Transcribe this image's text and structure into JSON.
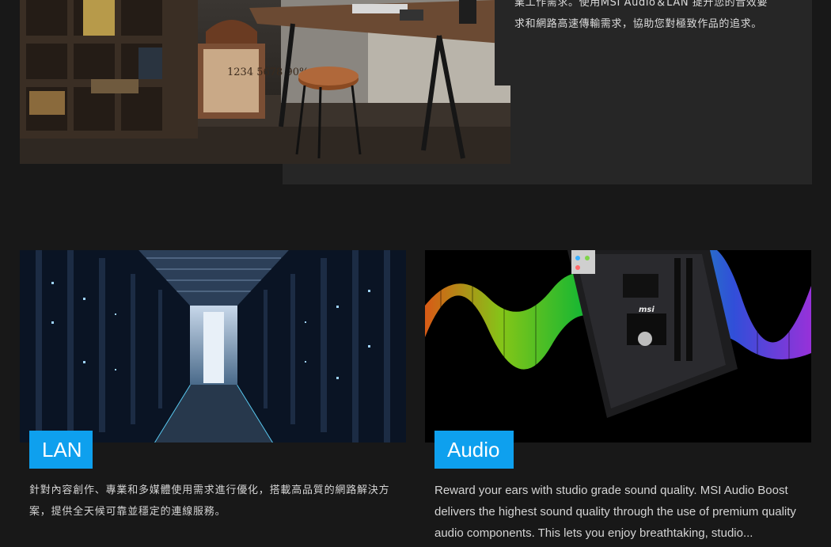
{
  "intro": {
    "text": "業工作需求。使用MSI Audio＆LAN 提升您的音效要求和網路高速傳輸需求，協助您對極致作品的追求。"
  },
  "photo_labels": {
    "box_numbers": "1234 5678 90%"
  },
  "cards": [
    {
      "title": "LAN",
      "description": "針對內容創作、專業和多媒體使用需求進行優化，搭載高品質的網路解決方案，提供全天候可靠並穩定的連線服務。"
    },
    {
      "title": "Audio",
      "description": "Reward your ears with studio grade sound quality. MSI Audio Boost delivers the highest sound quality through the use of premium quality audio components. This lets you enjoy breathtaking, studio..."
    }
  ],
  "colors": {
    "page_bg": "#181818",
    "panel_bg": "#262626",
    "accent": "#0ea0ee",
    "text": "#d9d9d9"
  }
}
